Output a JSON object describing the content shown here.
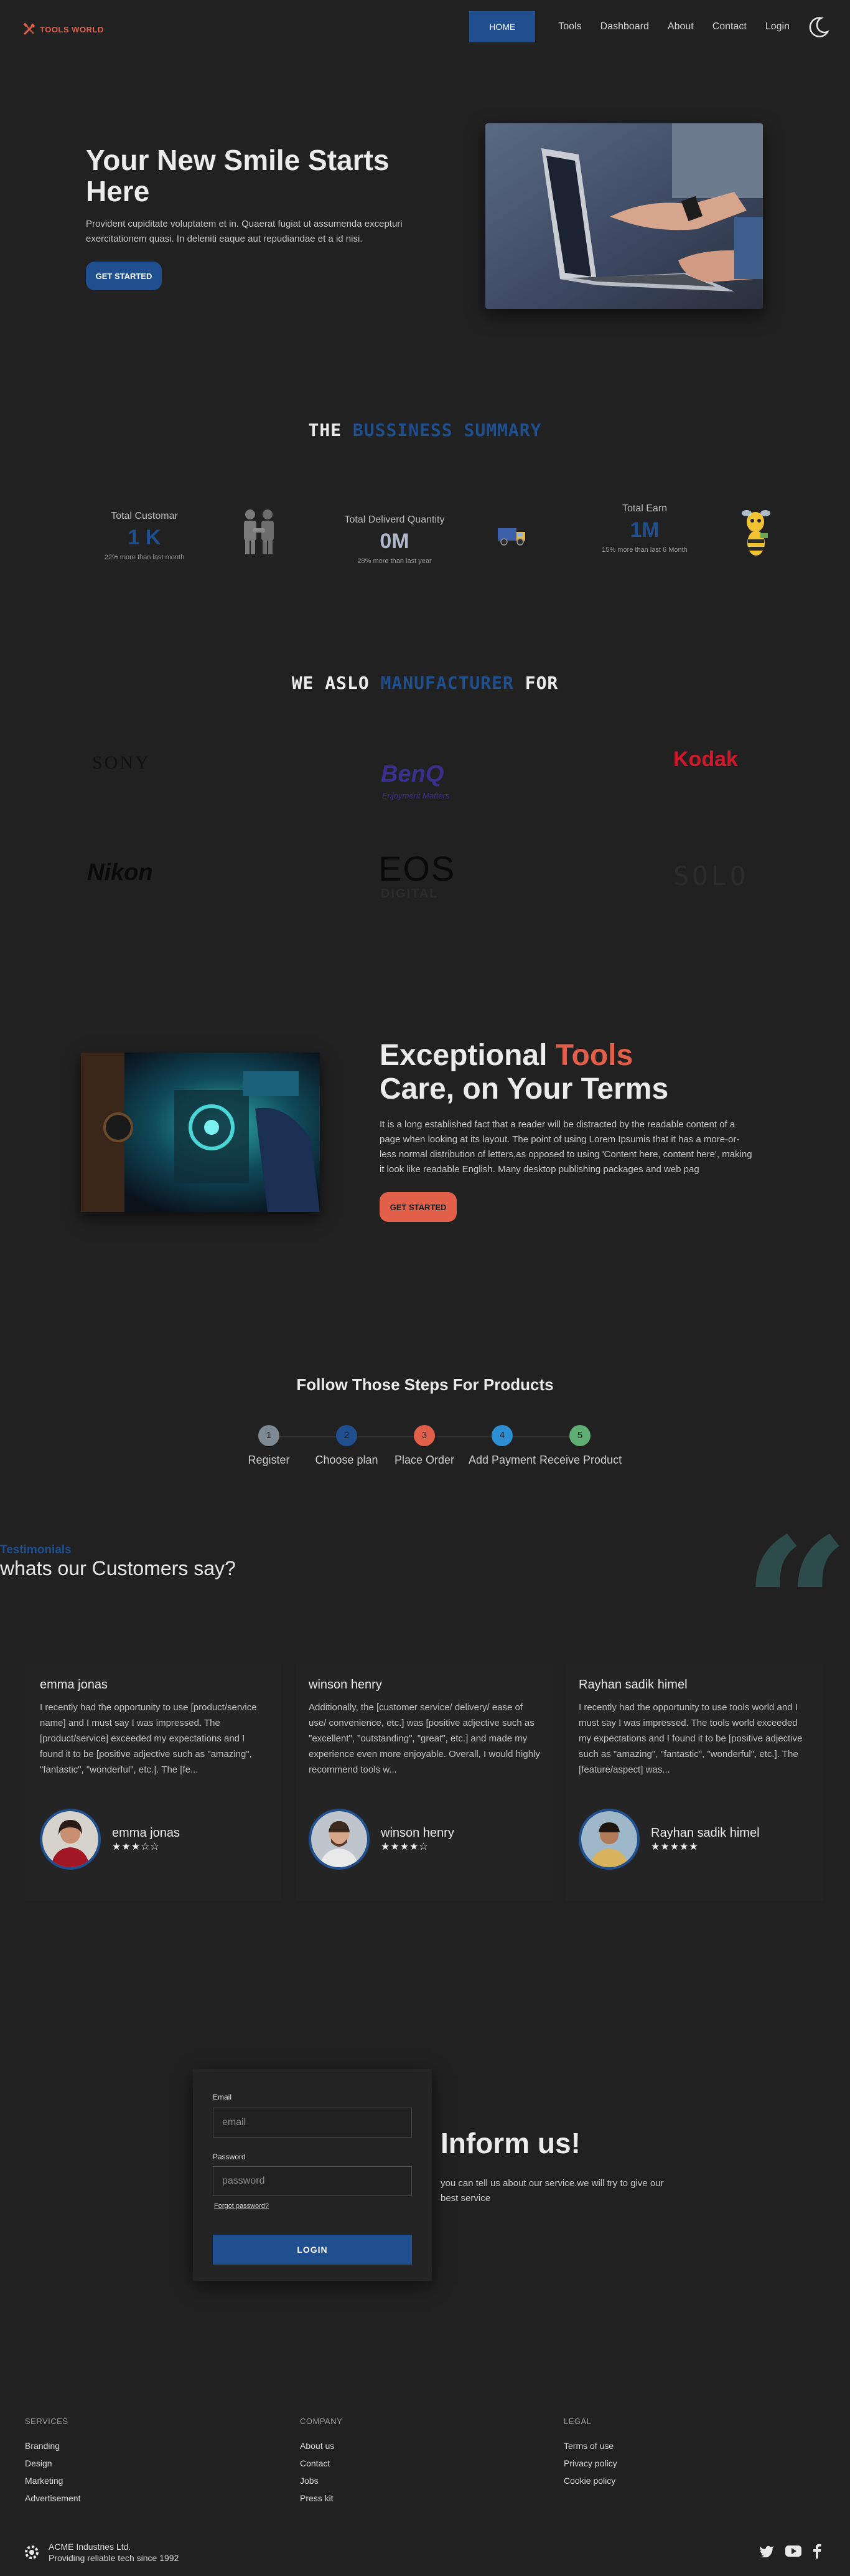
{
  "brand": {
    "name": "TOOLS WORLD"
  },
  "nav": {
    "home": "HOME",
    "tools": "Tools",
    "dashboard": "Dashboard",
    "about": "About",
    "contact": "Contact",
    "login": "Login"
  },
  "hero": {
    "title": "Your New Smile Starts Here",
    "description": "Provident cupiditate voluptatem et in. Quaerat fugiat ut assumenda excepturi exercitationem quasi. In deleniti eaque aut repudiandae et a id nisi.",
    "cta": "GET STARTED"
  },
  "summary": {
    "title_prefix": "THE",
    "title_highlight": "BUSSINESS SUMMARY",
    "stats": [
      {
        "label": "Total Customar",
        "value": "1 K",
        "note": "22% more than last month",
        "color": "#1f4f8e"
      },
      {
        "label": "Total Deliverd Quantity",
        "value": "0M",
        "note": "28% more than last year",
        "color": "#aeb7cc"
      },
      {
        "label": "Total Earn",
        "value": "1M",
        "note": "15% more than last 6 Month",
        "color": "#1f4f8e"
      }
    ]
  },
  "manufacturers": {
    "title_prefix": "WE ASLO",
    "title_highlight": "MANUFACTURER",
    "title_suffix": "FOR",
    "brands": [
      "SONY",
      "BenQ",
      "Enjoyment Matters",
      "Kodak",
      "Nikon",
      "EOS",
      "DIGITAL",
      "SOLO"
    ]
  },
  "tools_care": {
    "title_part1": "Exceptional",
    "title_highlight": "Tools",
    "title_part2": "Care, on Your Terms",
    "description": "It is a long established fact that a reader will be distracted by the readable content of a page when looking at its layout. The point of using Lorem Ipsumis that it has a more-or-less normal distribution of letters,as opposed to using 'Content here, content here', making it look like readable English. Many desktop publishing packages and web pag",
    "cta": "GET STARTED"
  },
  "steps": {
    "title": "Follow Those Steps For Products",
    "items": [
      {
        "num": "1",
        "label": "Register",
        "color": "#7d8a93"
      },
      {
        "num": "2",
        "label": "Choose plan",
        "color": "#1f4f8e"
      },
      {
        "num": "3",
        "label": "Place Order",
        "color": "#e2604a"
      },
      {
        "num": "4",
        "label": "Add Payment",
        "color": "#2d8fd3"
      },
      {
        "num": "5",
        "label": "Receive Product",
        "color": "#5fae74"
      }
    ]
  },
  "testimonials": {
    "kicker": "Testimonials",
    "title": "whats our Customers say?",
    "quote_mark": "“",
    "items": [
      {
        "name": "emma jonas",
        "text": "I recently had the opportunity to use [product/service name] and I must say I was impressed. The [product/service] exceeded my expectations and I found it to be [positive adjective such as \"amazing\", \"fantastic\", \"wonderful\", etc.]. The [fe...",
        "stars": "★★★☆☆",
        "rating": 3
      },
      {
        "name": "winson henry",
        "text": "Additionally, the [customer service/ delivery/ ease of use/ convenience, etc.] was [positive adjective such as \"excellent\", \"outstanding\", \"great\", etc.] and made my experience even more enjoyable. Overall, I would highly recommend tools w...",
        "stars": "★★★★☆",
        "rating": 4
      },
      {
        "name": "Rayhan sadik himel",
        "text": "I recently had the opportunity to use tools world and I must say I was impressed. The tools world exceeded my expectations and I found it to be [positive adjective such as \"amazing\", \"fantastic\", \"wonderful\", etc.]. The [feature/aspect] was...",
        "stars": "★★★★★",
        "rating": 5
      }
    ]
  },
  "login_form": {
    "email_label": "Email",
    "email_placeholder": "email",
    "password_label": "Password",
    "password_placeholder": "password",
    "forgot": "Forgot password?",
    "submit": "LOGIN"
  },
  "inform": {
    "title": "Inform us!",
    "text": "you can tell us about our service.we will try to give our best service"
  },
  "footer": {
    "services": {
      "heading": "SERVICES",
      "links": [
        "Branding",
        "Design",
        "Marketing",
        "Advertisement"
      ]
    },
    "company": {
      "heading": "COMPANY",
      "links": [
        "About us",
        "Contact",
        "Jobs",
        "Press kit"
      ]
    },
    "legal": {
      "heading": "LEGAL",
      "links": [
        "Terms of use",
        "Privacy policy",
        "Cookie policy"
      ]
    },
    "company_name": "ACME Industries Ltd.",
    "company_tagline": "Providing reliable tech since 1992",
    "social_icons": [
      "twitter-icon",
      "youtube-icon",
      "facebook-icon"
    ]
  }
}
